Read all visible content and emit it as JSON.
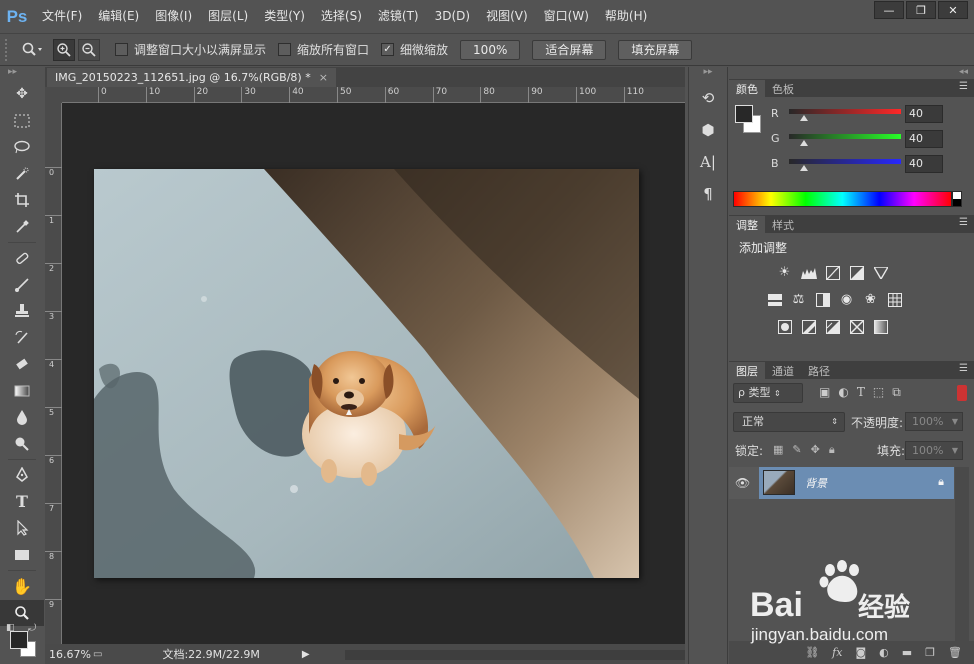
{
  "app": {
    "logo": "Ps"
  },
  "menu": [
    "文件(F)",
    "编辑(E)",
    "图像(I)",
    "图层(L)",
    "类型(Y)",
    "选择(S)",
    "滤镜(T)",
    "3D(D)",
    "视图(V)",
    "窗口(W)",
    "帮助(H)"
  ],
  "window_controls": {
    "minimize": "—",
    "restore": "❐",
    "close": "✕"
  },
  "options": {
    "tool_icon": "zoom-icon",
    "zoom_in": "+",
    "zoom_out": "−",
    "resize_windows": "调整窗口大小以满屏显示",
    "zoom_all": "缩放所有窗口",
    "scrubby_zoom": "细微缩放",
    "scrubby_checked": "✓",
    "btn_100": "100%",
    "btn_fit": "适合屏幕",
    "btn_fill": "填充屏幕"
  },
  "document": {
    "tab_title": "IMG_20150223_112651.jpg @ 16.7%(RGB/8) *",
    "tab_close": "×",
    "ruler_h": [
      "0",
      "10",
      "20",
      "30",
      "40",
      "50",
      "60",
      "70",
      "80",
      "90",
      "100",
      "110"
    ],
    "ruler_v": [
      "0",
      "1",
      "2",
      "3",
      "4",
      "5",
      "6",
      "7",
      "8",
      "9"
    ],
    "zoom": "16.67%",
    "doc_info": "文档:22.9M/22.9M",
    "status_arrow": "▶"
  },
  "color_panel": {
    "tabs": [
      "颜色",
      "色板"
    ],
    "sliders": [
      {
        "label": "R",
        "value": "40"
      },
      {
        "label": "G",
        "value": "40"
      },
      {
        "label": "B",
        "value": "40"
      }
    ]
  },
  "adjust_panel": {
    "tabs": [
      "调整",
      "样式"
    ],
    "title": "添加调整"
  },
  "layers_panel": {
    "tabs": [
      "图层",
      "通道",
      "路径"
    ],
    "filter": "ρ 类型",
    "blend": "正常",
    "opacity_label": "不透明度:",
    "opacity_value": "100%",
    "lock_label": "锁定:",
    "fill_label": "填充:",
    "fill_value": "100%",
    "layer_name": "背景"
  },
  "watermark": {
    "brand": "Bai",
    "brand_cn": "经验",
    "url": "jingyan.baidu.com"
  },
  "colors": {
    "accent": "#6b8db3",
    "ps_blue": "#6db3f2"
  }
}
